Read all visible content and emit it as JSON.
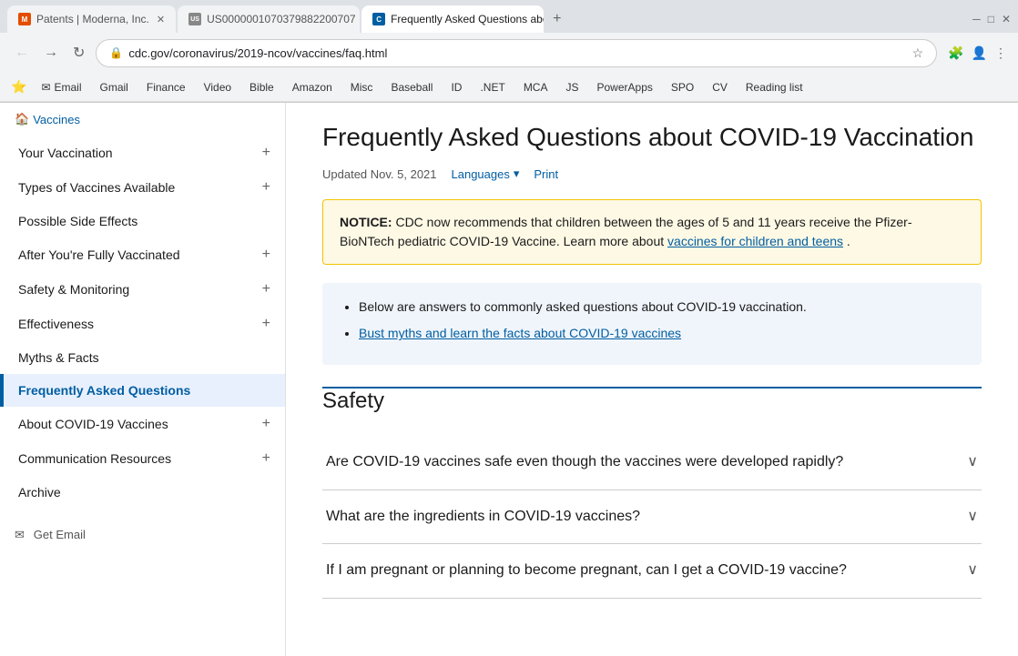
{
  "browser": {
    "tabs": [
      {
        "id": "tab1",
        "favicon_type": "moderna",
        "label": "Patents | Moderna, Inc.",
        "active": false
      },
      {
        "id": "tab2",
        "favicon_type": "patent",
        "label": "US0000001070379882200707",
        "active": false
      },
      {
        "id": "tab3",
        "favicon_type": "cdc",
        "label": "Frequently Asked Questions abo...",
        "active": true
      }
    ],
    "url": "cdc.gov/coronavirus/2019-ncov/vaccines/faq.html",
    "bookmarks": [
      {
        "label": "Email"
      },
      {
        "label": "Gmail"
      },
      {
        "label": "Finance"
      },
      {
        "label": "Video"
      },
      {
        "label": "Bible"
      },
      {
        "label": "Amazon"
      },
      {
        "label": "Misc"
      },
      {
        "label": "Baseball"
      },
      {
        "label": "ID"
      },
      {
        "label": ".NET"
      },
      {
        "label": "MCA"
      },
      {
        "label": "JS"
      },
      {
        "label": "PowerApps"
      },
      {
        "label": "SPO"
      },
      {
        "label": "CV"
      },
      {
        "label": "Reading list"
      }
    ]
  },
  "sidebar": {
    "breadcrumb": "Vaccines",
    "items": [
      {
        "label": "Your Vaccination",
        "has_plus": true,
        "active": false
      },
      {
        "label": "Types of Vaccines Available",
        "has_plus": true,
        "active": false
      },
      {
        "label": "Possible Side Effects",
        "has_plus": false,
        "active": false
      },
      {
        "label": "After You're Fully Vaccinated",
        "has_plus": true,
        "active": false
      },
      {
        "label": "Safety & Monitoring",
        "has_plus": true,
        "active": false
      },
      {
        "label": "Effectiveness",
        "has_plus": true,
        "active": false
      },
      {
        "label": "Myths & Facts",
        "has_plus": false,
        "active": false
      },
      {
        "label": "Frequently Asked Questions",
        "has_plus": false,
        "active": true
      },
      {
        "label": "About COVID-19 Vaccines",
        "has_plus": true,
        "active": false
      },
      {
        "label": "Communication Resources",
        "has_plus": true,
        "active": false
      },
      {
        "label": "Archive",
        "has_plus": false,
        "active": false
      }
    ],
    "get_email_label": "Get Email"
  },
  "main": {
    "page_title": "Frequently Asked Questions about COVID-19 Vaccination",
    "updated_date": "Updated Nov. 5, 2021",
    "languages_label": "Languages",
    "print_label": "Print",
    "notice": {
      "label": "NOTICE:",
      "text": " CDC now recommends that children between the ages of 5 and 11 years receive the Pfizer-BioNTech pediatric COVID-19 Vaccine. Learn more about ",
      "link_text": "vaccines for children and teens",
      "link_suffix": "."
    },
    "info_bullets": [
      "Below are answers to commonly asked questions about COVID-19 vaccination.",
      "Bust myths and learn the facts about COVID-19 vaccines"
    ],
    "info_link": {
      "text": "Bust myths and learn the facts about COVID-19 vaccines",
      "href": "#"
    },
    "safety_section": {
      "title": "Safety",
      "questions": [
        {
          "text": "Are COVID-19 vaccines safe even though the vaccines were developed rapidly?"
        },
        {
          "text": "What are the ingredients in COVID-19 vaccines?"
        },
        {
          "text": "If I am pregnant or planning to become pregnant, can I get a COVID-19 vaccine?"
        }
      ]
    }
  }
}
